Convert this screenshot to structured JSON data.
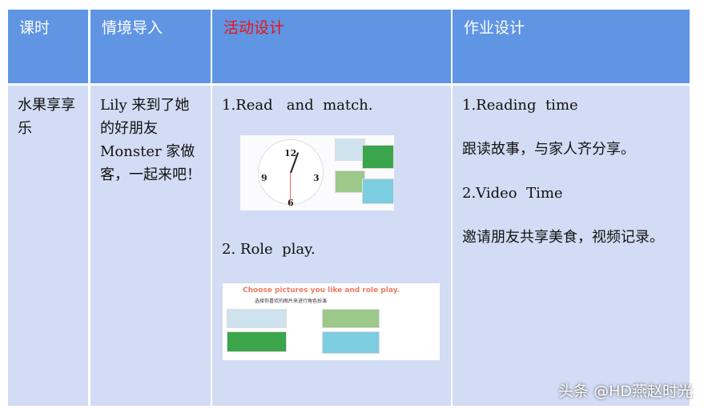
{
  "header": {
    "col1": "课时",
    "col2": "情境导入",
    "col3": "活动设计",
    "col4": "作业设计"
  },
  "row": {
    "lesson": "水果享享乐",
    "intro": "Lily  来到了她的好朋友 Monster  家做客，一起来吧！",
    "activity1": "1.Read   and  match.",
    "activity2": "2. Role  play.",
    "role_play_image_title": "Choose  pictures you like and role play.",
    "role_play_image_subtitle": "选择你喜欢的图片来进行角色扮演",
    "clock_numbers": [
      "12",
      "3",
      "6",
      "9"
    ],
    "hw1": "1.Reading  time",
    "hw1_desc": "跟读故事，与家人齐分享。",
    "hw2": "2.Video  Time",
    "hw2_desc": "邀请朋友共享美食，视频记录。"
  },
  "watermark": "头条 @HD燕赵时光",
  "colors": {
    "header_bg": "#5f95e3",
    "body_bg": "#d2dcf4",
    "highlight": "#f01010"
  }
}
